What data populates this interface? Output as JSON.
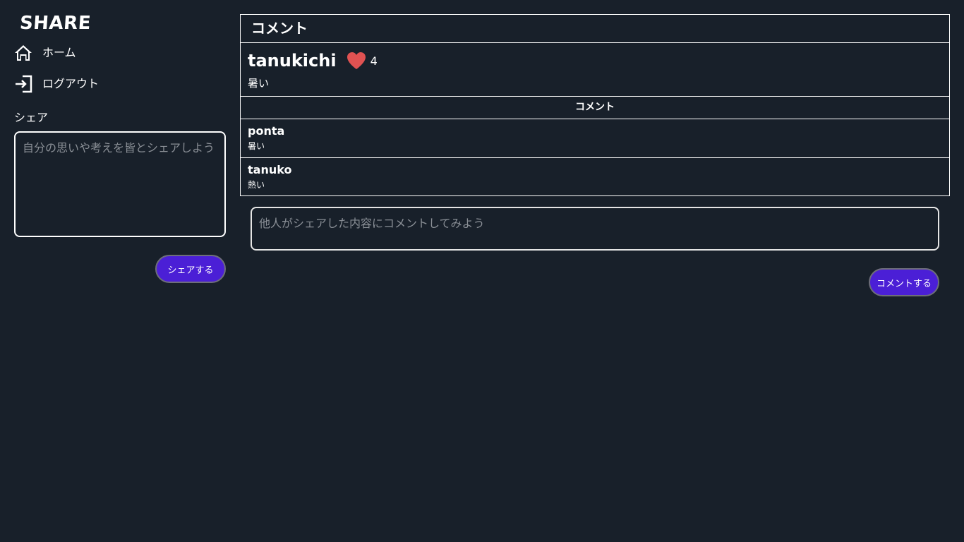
{
  "app": {
    "logo": "SHARE"
  },
  "sidebar": {
    "nav": [
      {
        "label": "ホーム",
        "icon": "home-icon"
      },
      {
        "label": "ログアウト",
        "icon": "logout-icon"
      }
    ],
    "share_heading": "シェア",
    "share_placeholder": "自分の思いや考えを皆とシェアしよう",
    "share_button": "シェアする"
  },
  "main": {
    "title": "コメント",
    "post": {
      "user": "tanukichi",
      "likes": "4",
      "text": "暑い"
    },
    "comments_heading": "コメント",
    "comments": [
      {
        "user": "ponta",
        "text": "暑い"
      },
      {
        "user": "tanuko",
        "text": "熱い"
      }
    ],
    "comment_placeholder": "他人がシェアした内容にコメントしてみよう",
    "comment_button": "コメントする"
  },
  "colors": {
    "background": "#18202a",
    "accent": "#4b1fd6",
    "heart": "#e05252",
    "text": "#ffffff"
  }
}
